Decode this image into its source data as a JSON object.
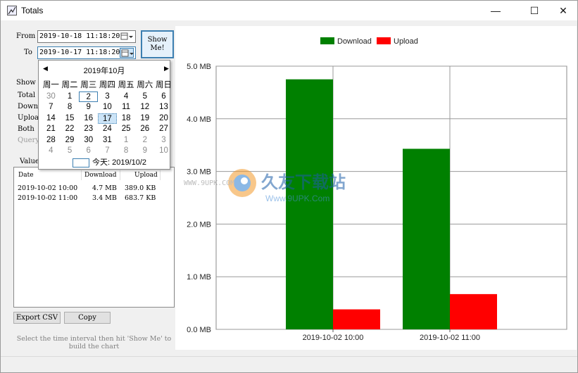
{
  "window": {
    "title": "Totals",
    "min": "—",
    "max": "☐",
    "close": "✕"
  },
  "form": {
    "from_label": "From",
    "to_label": "To",
    "from_value": "2019-10-18 11:18:20",
    "to_value": "2019-10-17 11:18:20",
    "show_button": "Show Me!",
    "show_label": "Show",
    "radio_total": "Total",
    "radio_download": "Downl",
    "radio_upload": "Uploa",
    "radio_both": "Both",
    "query_label": "Query",
    "values_label": "Value"
  },
  "calendar": {
    "month": "2019年10月",
    "weekdays": [
      "周一",
      "周二",
      "周三",
      "周四",
      "周五",
      "周六",
      "周日"
    ],
    "weeks": [
      [
        "30",
        "1",
        "2",
        "3",
        "4",
        "5",
        "6"
      ],
      [
        "7",
        "8",
        "9",
        "10",
        "11",
        "12",
        "13"
      ],
      [
        "14",
        "15",
        "16",
        "17",
        "18",
        "19",
        "20"
      ],
      [
        "21",
        "22",
        "23",
        "24",
        "25",
        "26",
        "27"
      ],
      [
        "28",
        "29",
        "30",
        "31",
        "1",
        "2",
        "3"
      ],
      [
        "4",
        "5",
        "6",
        "7",
        "8",
        "9",
        "10"
      ]
    ],
    "today_text": "今天: 2019/10/2"
  },
  "list": {
    "headers": [
      "Date",
      "Download",
      "Upload"
    ],
    "rows": [
      [
        "2019-10-02 10:00",
        "4.7 MB",
        "389.0 KB"
      ],
      [
        "2019-10-02 11:00",
        "3.4 MB",
        "683.7 KB"
      ]
    ]
  },
  "buttons": {
    "export": "Export CSV",
    "copy": "Copy"
  },
  "hint": "Select the time interval then hit 'Show Me' to build the chart",
  "watermark": {
    "brand": "久友下载站",
    "url": "WWW.9UPK.COM",
    "url2": "Www.9UPK.Com"
  },
  "chart_data": {
    "type": "bar",
    "categories": [
      "2019-10-02 10:00",
      "2019-10-02 11:00"
    ],
    "series": [
      {
        "name": "Download",
        "values": [
          4.75,
          3.43
        ],
        "color": "#008000"
      },
      {
        "name": "Upload",
        "values": [
          0.38,
          0.67
        ],
        "color": "#ff0000"
      }
    ],
    "yticks": [
      "0.0 MB",
      "1.0 MB",
      "2.0 MB",
      "3.0 MB",
      "4.0 MB",
      "5.0 MB"
    ],
    "ylim": [
      0,
      5
    ],
    "grid": true,
    "legend": "top-center"
  }
}
